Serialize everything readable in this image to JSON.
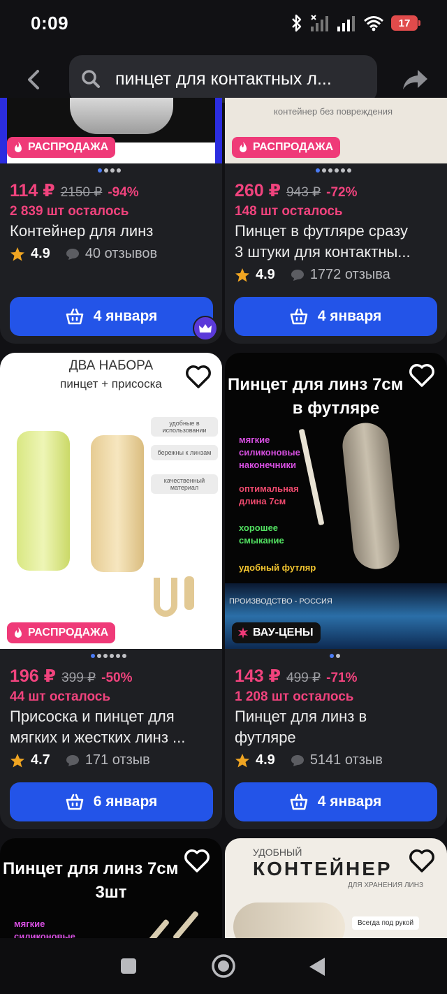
{
  "status_bar": {
    "time": "0:09",
    "battery": "17"
  },
  "header": {
    "search_query": "пинцет для контактных л..."
  },
  "products": [
    {
      "badge": "РАСПРОДАЖА",
      "price": "114 ₽",
      "old_price": "2150 ₽",
      "discount": "-94%",
      "stock": "2 839 шт осталось",
      "title_lines": [
        "Контейнер для линз"
      ],
      "rating": "4.9",
      "reviews": "40 отзывов",
      "delivery": "4 января"
    },
    {
      "image_text": "контейнер без повреждения",
      "badge": "РАСПРОДАЖА",
      "price": "260 ₽",
      "old_price": "943 ₽",
      "discount": "-72%",
      "stock": "148 шт осталось",
      "title_lines": [
        "Пинцет в футляре сразу",
        "3 штуки для контактны..."
      ],
      "rating": "4.9",
      "reviews": "1772 отзыва",
      "delivery": "4 января"
    },
    {
      "image_text": {
        "headline": "ДВА НАБОРА",
        "subline": "пинцет + присоска",
        "features": [
          "удобные в использовании",
          "бережны к линзам",
          "качественный материал"
        ]
      },
      "badge": "РАСПРОДАЖА",
      "price": "196 ₽",
      "old_price": "399 ₽",
      "discount": "-50%",
      "stock": "44 шт осталось",
      "title_lines": [
        "Присоска и пинцет для",
        "мягких и жестких линз ..."
      ],
      "rating": "4.7",
      "reviews": "171 отзыв",
      "delivery": "6 января"
    },
    {
      "image_text": {
        "headline_1": "Пинцет для линз 7см",
        "headline_2": "в футляре",
        "features": [
          "мягкие",
          "силиконовые",
          "наконечники",
          "оптимальная",
          "длина 7см",
          "хорошее",
          "смыкание",
          "удобный футляр"
        ],
        "footer": "ПРОИЗВОДСТВО - РОССИЯ"
      },
      "badge": "ВАУ-ЦЕНЫ",
      "price": "143 ₽",
      "old_price": "499 ₽",
      "discount": "-71%",
      "stock": "1 208 шт осталось",
      "title_lines": [
        "Пинцет для линз в",
        "футляре"
      ],
      "rating": "4.9",
      "reviews": "5141 отзыв",
      "delivery": "4 января"
    },
    {
      "image_text": {
        "headline_1": "Пинцет для линз 7см",
        "headline_2": "3шт",
        "features": [
          "мягкие",
          "силиконовые"
        ]
      }
    },
    {
      "image_text": {
        "top": "УДОБНЫЙ",
        "headline": "КОНТЕЙНЕР",
        "subline": "ДЛЯ ХРАНЕНИЯ ЛИНЗ",
        "tag": "Всегда под рукой"
      }
    }
  ],
  "colors": {
    "accent": "#2354e8",
    "price": "#f0437d",
    "badge": "#ef3a78",
    "card_bg": "#1e1f23",
    "page_bg": "#111114"
  }
}
